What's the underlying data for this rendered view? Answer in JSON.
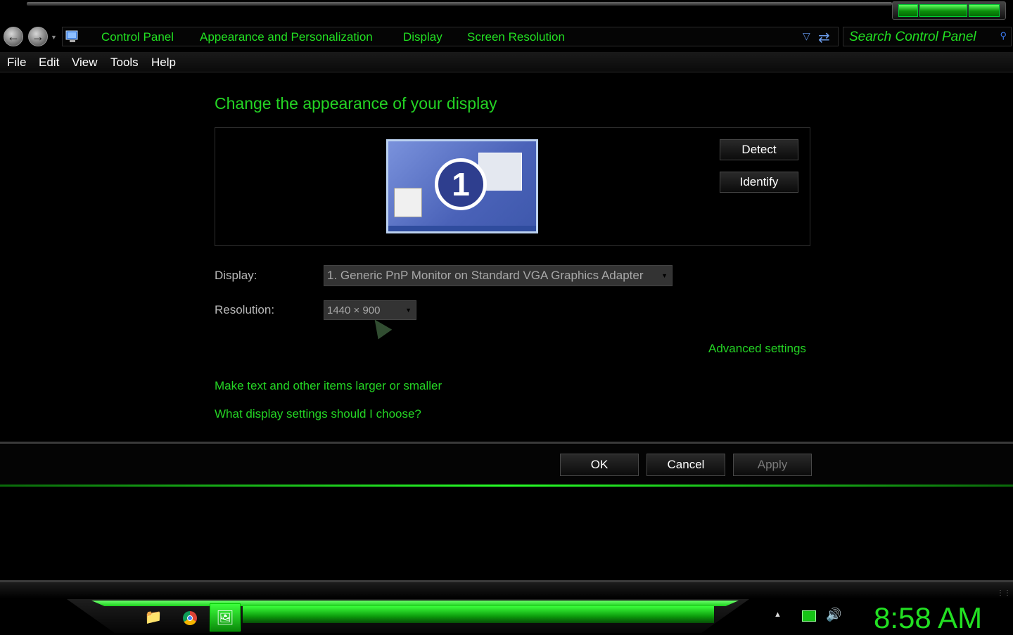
{
  "address_bar": {
    "crumbs": [
      "Control Panel",
      "Appearance and Personalization",
      "Display",
      "Screen Resolution"
    ],
    "search_placeholder": "Search Control Panel"
  },
  "menu": [
    "File",
    "Edit",
    "View",
    "Tools",
    "Help"
  ],
  "main": {
    "heading": "Change the appearance of your display",
    "monitor_number": "1",
    "detect_label": "Detect",
    "identify_label": "Identify",
    "display_label": "Display:",
    "display_value": "1. Generic PnP Monitor on Standard VGA Graphics Adapter",
    "resolution_label": "Resolution:",
    "resolution_value": "1440 × 900",
    "advanced_link": "Advanced settings",
    "text_size_link": "Make text and other items larger or smaller",
    "help_link": "What display settings should I choose?"
  },
  "footer_buttons": {
    "ok": "OK",
    "cancel": "Cancel",
    "apply": "Apply"
  },
  "taskbar": {
    "clock": "8:58 AM",
    "apps": [
      "folder-icon",
      "chrome-icon",
      "display-settings-icon"
    ]
  },
  "colors": {
    "accent_green": "#22e022",
    "background": "#000000"
  }
}
